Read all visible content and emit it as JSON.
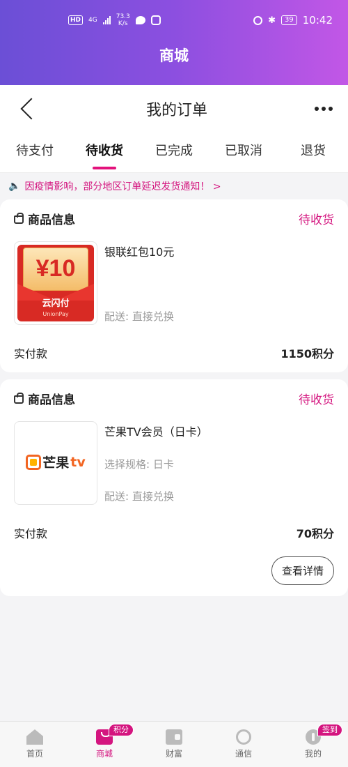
{
  "status_bar": {
    "network_badge": "HD",
    "network_type": "4G",
    "speed_value": "73.3",
    "speed_unit": "K/s",
    "battery": "39",
    "time": "10:42"
  },
  "hero": {
    "title": "商城"
  },
  "nav": {
    "title": "我的订单"
  },
  "tabs": [
    {
      "label": "待支付"
    },
    {
      "label": "待收货"
    },
    {
      "label": "已完成"
    },
    {
      "label": "已取消"
    },
    {
      "label": "退货"
    }
  ],
  "active_tab": "待收货",
  "notice": {
    "text": "因疫情影响，部分地区订单延迟发货通知！ >"
  },
  "orders": [
    {
      "header": "商品信息",
      "status": "待收货",
      "product_name": "银联红包10元",
      "spec": "",
      "shipping": "配送: 直接兑换",
      "paid_label": "实付款",
      "paid_value": "1150积分",
      "thumb": {
        "amount": "¥10",
        "brand": "云闪付",
        "sub": "UnionPay"
      }
    },
    {
      "header": "商品信息",
      "status": "待收货",
      "product_name": "芒果TV会员（日卡）",
      "spec": "选择规格:  日卡",
      "shipping": "配送: 直接兑换",
      "paid_label": "实付款",
      "paid_value": "70积分",
      "detail_button": "查看详情",
      "thumb": {
        "brand_text": "芒果",
        "brand_tv": "tv"
      }
    }
  ],
  "bottom_nav": [
    {
      "label": "首页",
      "icon": "home-icon"
    },
    {
      "label": "商城",
      "icon": "mall-icon",
      "badge": "积分"
    },
    {
      "label": "财富",
      "icon": "wealth-icon"
    },
    {
      "label": "通信",
      "icon": "communication-icon"
    },
    {
      "label": "我的",
      "icon": "mine-icon",
      "badge": "签到"
    }
  ],
  "colors": {
    "accent": "#d4157f",
    "hero_start": "#6b4fd6",
    "hero_end": "#c257e6"
  }
}
